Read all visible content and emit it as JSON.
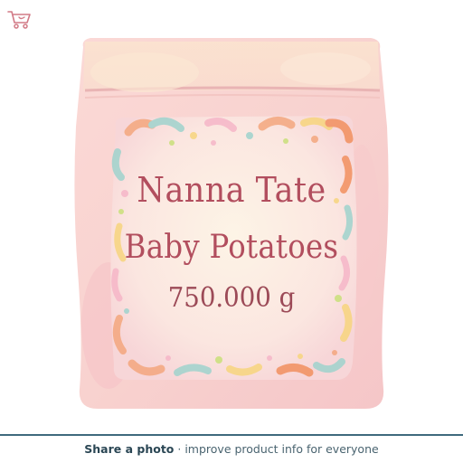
{
  "product": {
    "brand": "Nanna Tate",
    "name": "Baby Potatoes",
    "weight": "750.000 g"
  },
  "footer": {
    "cta": "Share a photo",
    "separator": " · ",
    "rest": "improve product info for everyone"
  },
  "icons": {
    "cart": "shopping-cart-icon"
  },
  "colors": {
    "bag_pink": "#f8cfd0",
    "label_text": "#b24e5e",
    "footer_text": "#2a4654",
    "divider": "#3f6a7d"
  }
}
